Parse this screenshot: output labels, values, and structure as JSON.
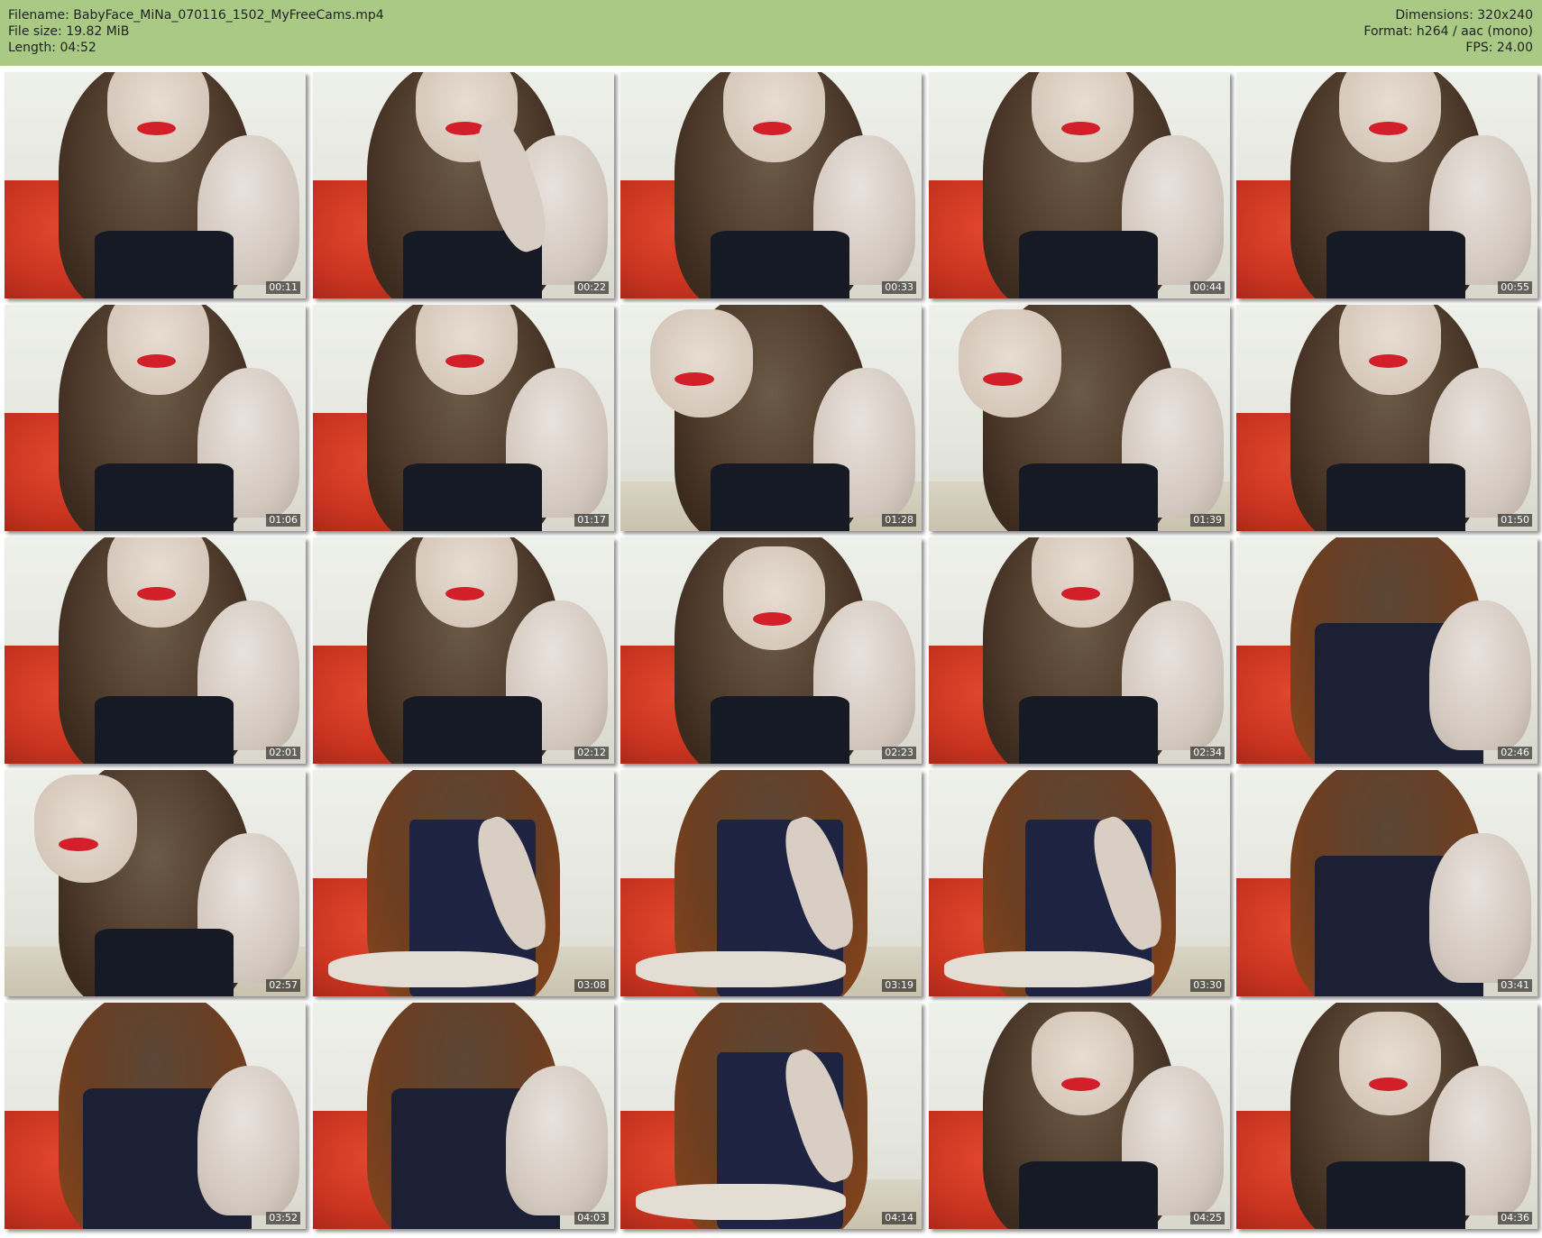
{
  "header": {
    "filename": "Filename: BabyFace_MiNa_070116_1502_MyFreeCams.mp4",
    "filesize": "File size: 19.82 MiB",
    "length": "Length: 04:52",
    "dimensions": "Dimensions: 320x240",
    "format": "Format: h264 / aac (mono)",
    "fps": "FPS: 24.00"
  },
  "colors": {
    "header_bg": "#a9c985",
    "bed_red": "#c93420",
    "lips_red": "#d21f2a",
    "top_black": "#161a24"
  },
  "thumbnails": [
    {
      "time": "00:11",
      "scene": "closeup"
    },
    {
      "time": "00:22",
      "scene": "closeup-arm"
    },
    {
      "time": "00:33",
      "scene": "closeup"
    },
    {
      "time": "00:44",
      "scene": "closeup"
    },
    {
      "time": "00:55",
      "scene": "closeup"
    },
    {
      "time": "01:06",
      "scene": "closeup"
    },
    {
      "time": "01:17",
      "scene": "closeup"
    },
    {
      "time": "01:28",
      "scene": "looking-down"
    },
    {
      "time": "01:39",
      "scene": "looking-down"
    },
    {
      "time": "01:50",
      "scene": "closeup"
    },
    {
      "time": "02:01",
      "scene": "closeup"
    },
    {
      "time": "02:12",
      "scene": "closeup"
    },
    {
      "time": "02:23",
      "scene": "face-up"
    },
    {
      "time": "02:34",
      "scene": "closeup"
    },
    {
      "time": "02:46",
      "scene": "torso"
    },
    {
      "time": "02:57",
      "scene": "looking-down"
    },
    {
      "time": "03:08",
      "scene": "dress"
    },
    {
      "time": "03:19",
      "scene": "dress"
    },
    {
      "time": "03:30",
      "scene": "dress"
    },
    {
      "time": "03:41",
      "scene": "torso"
    },
    {
      "time": "03:52",
      "scene": "torso"
    },
    {
      "time": "04:03",
      "scene": "torso"
    },
    {
      "time": "04:14",
      "scene": "dress"
    },
    {
      "time": "04:25",
      "scene": "face-up"
    },
    {
      "time": "04:36",
      "scene": "face-up"
    }
  ]
}
